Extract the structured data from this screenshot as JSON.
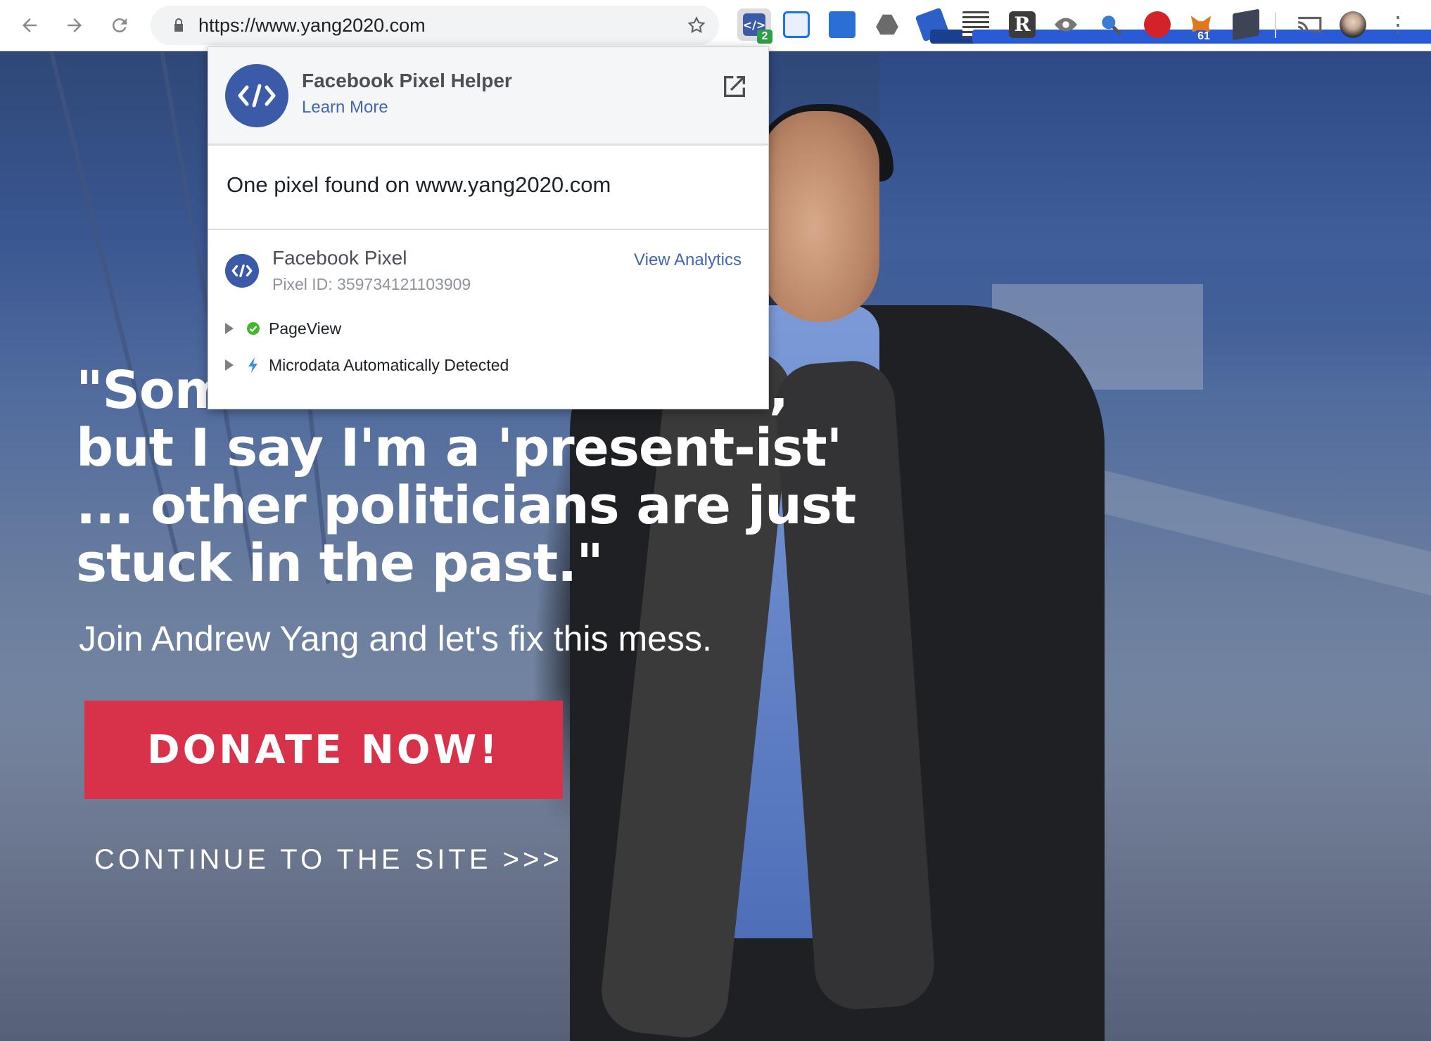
{
  "browser": {
    "url": "https://www.yang2020.com",
    "extensions": [
      {
        "icon": "facebook-pixel-helper-icon",
        "badge": "2",
        "badge_color": "#2e9e47"
      },
      {
        "icon": "window-icon",
        "badge": ""
      },
      {
        "icon": "screen-share-icon",
        "badge": ""
      },
      {
        "icon": "google-drive-icon",
        "badge": ""
      },
      {
        "icon": "tag-icon",
        "badge": "61",
        "badge_color": "#1a3f8f"
      },
      {
        "icon": "datalayer-icon",
        "badge": "61",
        "badge_color": "#2a5bd7"
      },
      {
        "icon": "readability-r-icon",
        "badge": ""
      },
      {
        "icon": "eye-icon",
        "badge": ""
      },
      {
        "icon": "magnifier-icon",
        "badge": ""
      },
      {
        "icon": "blocked-icon",
        "badge": ""
      },
      {
        "icon": "metamask-fox-icon",
        "badge": ""
      },
      {
        "icon": "note-icon",
        "badge": ""
      },
      {
        "icon": "cast-icon",
        "badge": ""
      },
      {
        "icon": "profile-avatar-icon",
        "badge": ""
      },
      {
        "icon": "more-vert-icon",
        "badge": ""
      }
    ]
  },
  "hero": {
    "headline_lines": [
      "\"Some call me a futurist,",
      "but I say I'm a 'present-ist'",
      "... other politicians are just",
      "stuck in the past.\""
    ],
    "subhead": "Join Andrew Yang and let's fix this mess.",
    "donate_label": "DONATE NOW!",
    "continue_label": "CONTINUE TO THE SITE >>>"
  },
  "popup": {
    "title": "Facebook Pixel Helper",
    "learn_more": "Learn More",
    "found_text": "One pixel found on www.yang2020.com",
    "pixel_name": "Facebook Pixel",
    "pixel_id": "Pixel ID: 359734121103909",
    "view_analytics": "View Analytics",
    "events": [
      {
        "label": "PageView",
        "status": "success"
      },
      {
        "label": "Microdata Automatically Detected",
        "status": "info"
      }
    ]
  },
  "colors": {
    "donate": "#d8324a",
    "facebook_blue": "#3b5ba8",
    "link_blue": "#4267b2",
    "success_green": "#42b72a",
    "info_blue": "#3a8ee6"
  }
}
